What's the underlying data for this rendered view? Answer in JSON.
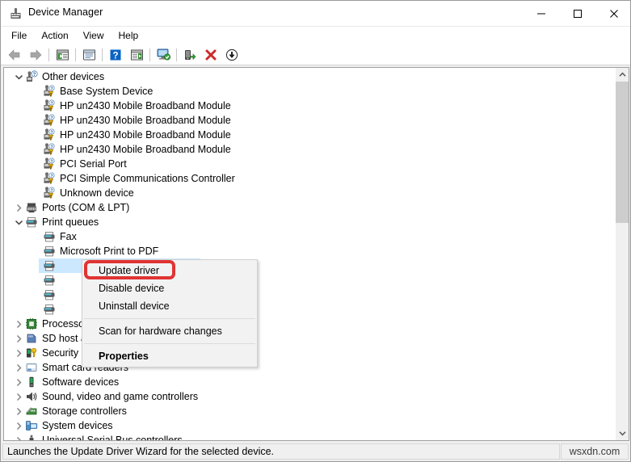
{
  "window": {
    "title": "Device Manager",
    "icon": "device-manager-icon",
    "controls": {
      "minimize": "minimize-icon",
      "maximize": "maximize-icon",
      "close": "close-icon"
    }
  },
  "menubar": {
    "items": [
      {
        "label": "File"
      },
      {
        "label": "Action"
      },
      {
        "label": "View"
      },
      {
        "label": "Help"
      }
    ]
  },
  "toolbar": {
    "buttons": [
      {
        "name": "back-arrow-icon"
      },
      {
        "name": "forward-arrow-icon"
      },
      {
        "name": "show-hide-console-tree-icon"
      },
      {
        "name": "properties-icon"
      },
      {
        "name": "help-icon"
      },
      {
        "name": "show-hide-action-pane-icon"
      },
      {
        "name": "scan-for-hardware-changes-icon"
      },
      {
        "name": "update-driver-icon"
      },
      {
        "name": "uninstall-device-icon"
      },
      {
        "name": "disable-device-icon"
      }
    ]
  },
  "tree": {
    "items": [
      {
        "label": "Other devices",
        "indent": 0,
        "chevron": "down",
        "icon": "unknown-device-icon",
        "selected": false
      },
      {
        "label": "Base System Device",
        "indent": 1,
        "chevron": "none",
        "icon": "warning-device-icon",
        "selected": false
      },
      {
        "label": "HP un2430 Mobile Broadband Module",
        "indent": 1,
        "chevron": "none",
        "icon": "warning-device-icon",
        "selected": false
      },
      {
        "label": "HP un2430 Mobile Broadband Module",
        "indent": 1,
        "chevron": "none",
        "icon": "warning-device-icon",
        "selected": false
      },
      {
        "label": "HP un2430 Mobile Broadband Module",
        "indent": 1,
        "chevron": "none",
        "icon": "warning-device-icon",
        "selected": false
      },
      {
        "label": "HP un2430 Mobile Broadband Module",
        "indent": 1,
        "chevron": "none",
        "icon": "warning-device-icon",
        "selected": false
      },
      {
        "label": "PCI Serial Port",
        "indent": 1,
        "chevron": "none",
        "icon": "warning-device-icon",
        "selected": false
      },
      {
        "label": "PCI Simple Communications Controller",
        "indent": 1,
        "chevron": "none",
        "icon": "warning-device-icon",
        "selected": false
      },
      {
        "label": "Unknown device",
        "indent": 1,
        "chevron": "none",
        "icon": "warning-device-icon",
        "selected": false
      },
      {
        "label": "Ports (COM & LPT)",
        "indent": 0,
        "chevron": "right",
        "icon": "port-icon",
        "selected": false
      },
      {
        "label": "Print queues",
        "indent": 0,
        "chevron": "down",
        "icon": "printer-icon",
        "selected": false
      },
      {
        "label": "Fax",
        "indent": 1,
        "chevron": "none",
        "icon": "printer-icon",
        "selected": false
      },
      {
        "label": "Microsoft Print to PDF",
        "indent": 1,
        "chevron": "none",
        "icon": "printer-icon",
        "selected": false
      },
      {
        "label": "",
        "indent": 1,
        "chevron": "none",
        "icon": "printer-icon",
        "selected": true
      },
      {
        "label": "",
        "indent": 1,
        "chevron": "none",
        "icon": "printer-icon",
        "selected": false
      },
      {
        "label": "",
        "indent": 1,
        "chevron": "none",
        "icon": "printer-icon",
        "selected": false
      },
      {
        "label": "",
        "indent": 1,
        "chevron": "none",
        "icon": "printer-icon",
        "selected": false
      },
      {
        "label": "Processors",
        "indent": 0,
        "chevron": "right",
        "icon": "processor-icon",
        "selected": false
      },
      {
        "label": "SD host adapters",
        "indent": 0,
        "chevron": "right",
        "icon": "sd-host-icon",
        "selected": false
      },
      {
        "label": "Security devices",
        "indent": 0,
        "chevron": "right",
        "icon": "security-device-icon",
        "selected": false
      },
      {
        "label": "Smart card readers",
        "indent": 0,
        "chevron": "right",
        "icon": "smart-card-reader-icon",
        "selected": false
      },
      {
        "label": "Software devices",
        "indent": 0,
        "chevron": "right",
        "icon": "software-device-icon",
        "selected": false
      },
      {
        "label": "Sound, video and game controllers",
        "indent": 0,
        "chevron": "right",
        "icon": "sound-controller-icon",
        "selected": false
      },
      {
        "label": "Storage controllers",
        "indent": 0,
        "chevron": "right",
        "icon": "storage-controller-icon",
        "selected": false
      },
      {
        "label": "System devices",
        "indent": 0,
        "chevron": "right",
        "icon": "system-device-icon",
        "selected": false
      },
      {
        "label": "Universal Serial Bus controllers",
        "indent": 0,
        "chevron": "right",
        "icon": "usb-controller-icon",
        "selected": false
      }
    ]
  },
  "context_menu": {
    "items": [
      {
        "label": "Update driver",
        "bold": false,
        "highlighted": true
      },
      {
        "label": "Disable device",
        "bold": false,
        "highlighted": false
      },
      {
        "label": "Uninstall device",
        "bold": false,
        "highlighted": false
      },
      {
        "separator": true
      },
      {
        "label": "Scan for hardware changes",
        "bold": false,
        "highlighted": false
      },
      {
        "separator": true
      },
      {
        "label": "Properties",
        "bold": true,
        "highlighted": false
      }
    ]
  },
  "annotation": {
    "color": "#e03434",
    "target": "Update driver"
  },
  "statusbar": {
    "text": "Launches the Update Driver Wizard for the selected device.",
    "watermark": "wsxdn.com"
  },
  "scrollbar": {
    "up_arrow": "chevron-up-icon",
    "down_arrow": "chevron-down-icon"
  },
  "colors": {
    "selection": "#cce8ff",
    "annotation_red": "#e03434",
    "window_bg": "#f0f0f0"
  }
}
